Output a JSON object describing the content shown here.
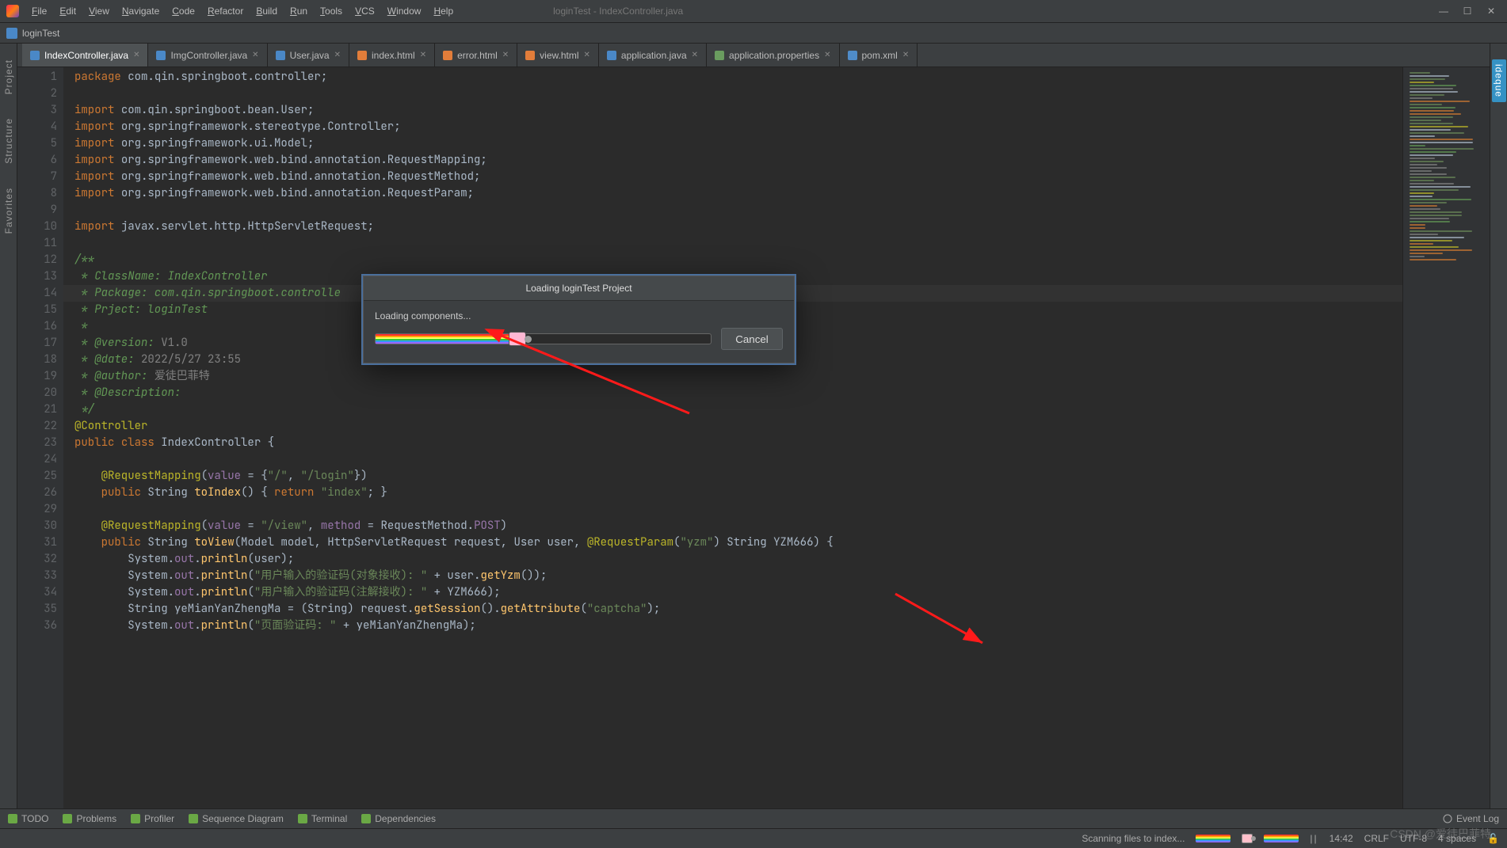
{
  "window": {
    "title": "loginTest - IndexController.java"
  },
  "menu": [
    "File",
    "Edit",
    "View",
    "Navigate",
    "Code",
    "Refactor",
    "Build",
    "Run",
    "Tools",
    "VCS",
    "Window",
    "Help"
  ],
  "breadcrumb": "loginTest",
  "tabs": [
    {
      "label": "IndexController.java",
      "icon": "j",
      "active": true
    },
    {
      "label": "ImgController.java",
      "icon": "j"
    },
    {
      "label": "User.java",
      "icon": "j"
    },
    {
      "label": "index.html",
      "icon": "h"
    },
    {
      "label": "error.html",
      "icon": "h"
    },
    {
      "label": "view.html",
      "icon": "h"
    },
    {
      "label": "application.java",
      "icon": "j"
    },
    {
      "label": "application.properties",
      "icon": "p"
    },
    {
      "label": "pom.xml",
      "icon": "m"
    }
  ],
  "left_tools": [
    "Project",
    "Structure",
    "Favorites"
  ],
  "right_tools": [
    "ideque"
  ],
  "gutter_start": 1,
  "code_lines": [
    {
      "n": 1,
      "html": "<span class='kw'>package</span> <span class='pkg'>com.qin.springboot.controller</span>;"
    },
    {
      "n": 2,
      "html": ""
    },
    {
      "n": 3,
      "html": "<span class='kw'>import</span> <span class='pkg'>com.qin.springboot.bean.User</span>;"
    },
    {
      "n": 4,
      "html": "<span class='kw'>import</span> <span class='pkg'>org.springframework.stereotype.Controller</span>;"
    },
    {
      "n": 5,
      "html": "<span class='kw'>import</span> <span class='pkg'>org.springframework.ui.Model</span>;"
    },
    {
      "n": 6,
      "html": "<span class='kw'>import</span> <span class='pkg'>org.springframework.web.bind.annotation.RequestMapping</span>;"
    },
    {
      "n": 7,
      "html": "<span class='kw'>import</span> <span class='pkg'>org.springframework.web.bind.annotation.RequestMethod</span>;"
    },
    {
      "n": 8,
      "html": "<span class='kw'>import</span> <span class='pkg'>org.springframework.web.bind.annotation.RequestParam</span>;"
    },
    {
      "n": 9,
      "html": ""
    },
    {
      "n": 10,
      "html": "<span class='kw'>import</span> <span class='pkg'>javax.servlet.http.HttpServletRequest</span>;"
    },
    {
      "n": 11,
      "html": ""
    },
    {
      "n": 12,
      "html": "<span class='doc'>/**</span>"
    },
    {
      "n": 13,
      "html": "<span class='doc'> * ClassName: IndexController</span>"
    },
    {
      "n": 14,
      "html": "<span class='doc'> * Package: com.qin.springboot.controlle</span>"
    },
    {
      "n": 15,
      "html": "<span class='doc'> * Prject: loginTest</span>"
    },
    {
      "n": 16,
      "html": "<span class='doc'> *</span>"
    },
    {
      "n": 17,
      "html": "<span class='doc'> * @version:</span> <span class='com'>V1.0</span>"
    },
    {
      "n": 18,
      "html": "<span class='doc'> * @date:</span> <span class='com'>2022/5/27 23:55</span>"
    },
    {
      "n": 19,
      "html": "<span class='doc'> * @author:</span> <span class='com'>爱徒巴菲特</span>"
    },
    {
      "n": 20,
      "html": "<span class='doc'> * @Description:</span>"
    },
    {
      "n": 21,
      "html": "<span class='doc'> */</span>"
    },
    {
      "n": 22,
      "html": "<span class='ann'>@Controller</span>"
    },
    {
      "n": 23,
      "html": "<span class='kw'>public</span> <span class='kw'>class</span> <span class='type'>IndexController</span> {"
    },
    {
      "n": 24,
      "html": ""
    },
    {
      "n": 25,
      "html": "    <span class='ann'>@RequestMapping</span>(<span class='field'>value</span> = {<span class='str'>\"/\"</span>, <span class='str'>\"/login\"</span>})"
    },
    {
      "n": 26,
      "html": "    <span class='kw'>public</span> <span class='type'>String</span> <span class='fn'>toIndex</span>() { <span class='kw'>return</span> <span class='str'>\"index\"</span>; }"
    },
    {
      "n": 29,
      "html": ""
    },
    {
      "n": 30,
      "html": "    <span class='ann'>@RequestMapping</span>(<span class='field'>value</span> = <span class='str'>\"/view\"</span>, <span class='field'>method</span> = RequestMethod.<span class='field'>POST</span>)"
    },
    {
      "n": 31,
      "html": "    <span class='kw'>public</span> <span class='type'>String</span> <span class='fn'>toView</span>(Model model, HttpServletRequest request, User user, <span class='ann'>@RequestParam</span>(<span class='str'>\"yzm\"</span>) <span class='type'>String</span> YZM666) {"
    },
    {
      "n": 32,
      "html": "        System.<span class='field'>out</span>.<span class='fn'>println</span>(user);"
    },
    {
      "n": 33,
      "html": "        System.<span class='field'>out</span>.<span class='fn'>println</span>(<span class='str'>\"用户输入的验证码(对象接收): \"</span> + user.<span class='fn'>getYzm</span>());"
    },
    {
      "n": 34,
      "html": "        System.<span class='field'>out</span>.<span class='fn'>println</span>(<span class='str'>\"用户输入的验证码(注解接收): \"</span> + YZM666);"
    },
    {
      "n": 35,
      "html": "        <span class='type'>String</span> yeMianYanZhengMa = (<span class='type'>String</span>) request.<span class='fn'>getSession</span>().<span class='fn'>getAttribute</span>(<span class='str'>\"captcha\"</span>);"
    },
    {
      "n": 36,
      "html": "        System.<span class='field'>out</span>.<span class='fn'>println</span>(<span class='str'>\"页面验证码: \"</span> + yeMianYanZhengMa);"
    }
  ],
  "highlight_line_index": 13,
  "dialog": {
    "title": "Loading loginTest Project",
    "text": "Loading components...",
    "progress_pct": 42,
    "cancel": "Cancel"
  },
  "toolstrip": [
    "TODO",
    "Problems",
    "Profiler",
    "Sequence Diagram",
    "Terminal",
    "Dependencies"
  ],
  "status": {
    "task": "Scanning files to index...",
    "time": "14:42",
    "le": "CRLF",
    "enc": "UTF-8",
    "indent": "4 spaces",
    "event": "Event Log"
  },
  "watermark": "CSDN @爱徒巴菲特"
}
